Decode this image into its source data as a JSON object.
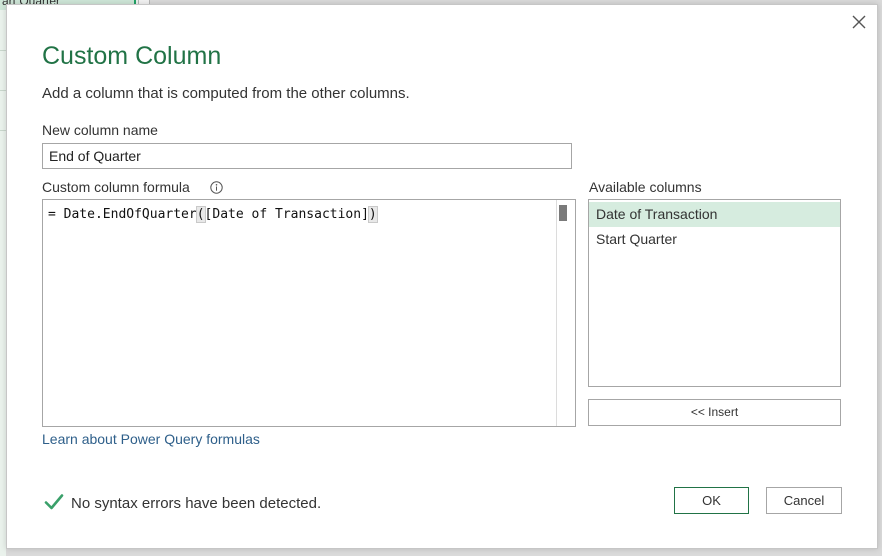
{
  "background": {
    "tab_label": "art Quarter"
  },
  "dialog": {
    "title": "Custom Column",
    "subtitle": "Add a column that is computed from the other columns.",
    "new_column_label": "New column name",
    "new_column_value": "End of Quarter",
    "formula_label": "Custom column formula",
    "formula": {
      "prefix": "= Date.EndOfQuarter",
      "open_paren": "(",
      "argument": "[Date of Transaction]",
      "close_paren": ")"
    },
    "available_label": "Available columns",
    "available_columns": [
      {
        "label": "Date of Transaction",
        "selected": true
      },
      {
        "label": "Start Quarter",
        "selected": false
      }
    ],
    "insert_label": "<< Insert",
    "learn_link": "Learn about Power Query formulas",
    "status_text": "No syntax errors have been detected.",
    "ok_label": "OK",
    "cancel_label": "Cancel"
  },
  "icons": {
    "close": "close-icon",
    "info": "info-icon",
    "status": "checkmark-icon"
  },
  "colors": {
    "accent": "#217346",
    "selection": "#d6ecdf",
    "link": "#2e5f8a",
    "check": "#3aa06a"
  }
}
